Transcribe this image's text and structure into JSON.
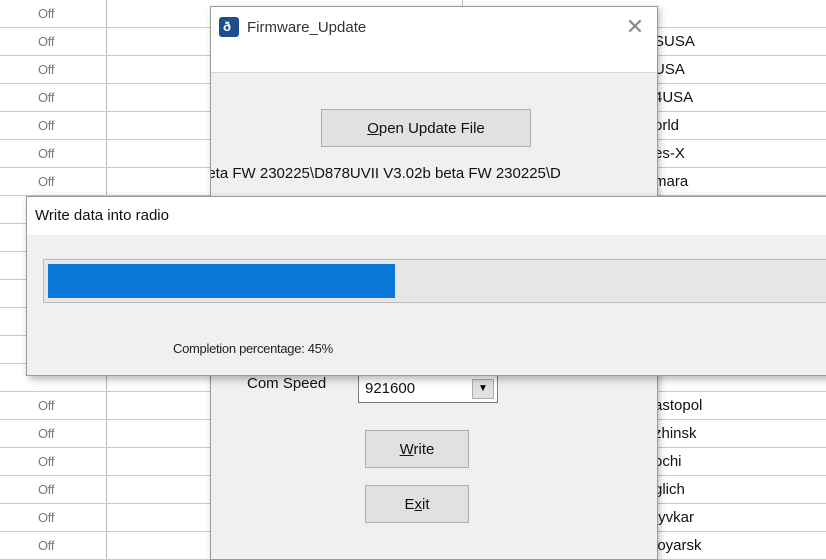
{
  "background_table": {
    "rows": [
      {
        "status": "Off",
        "name": ""
      },
      {
        "status": "Off",
        "name": "SUSA"
      },
      {
        "status": "Off",
        "name": "USA"
      },
      {
        "status": "Off",
        "name": "4USA"
      },
      {
        "status": "Off",
        "name": "orld"
      },
      {
        "status": "Off",
        "name": "es-X"
      },
      {
        "status": "Off",
        "name": "mara"
      },
      {
        "status": "",
        "name": ""
      },
      {
        "status": "",
        "name": ""
      },
      {
        "status": "",
        "name": ""
      },
      {
        "status": "",
        "name": ""
      },
      {
        "status": "",
        "name": ""
      },
      {
        "status": "",
        "name": ""
      },
      {
        "status": "",
        "name": ""
      },
      {
        "status": "Off",
        "name": "astopol"
      },
      {
        "status": "Off",
        "name": "zhinsk"
      },
      {
        "status": "Off",
        "name": "ochi"
      },
      {
        "status": "Off",
        "name": "glich"
      },
      {
        "status": "Off",
        "name": "tyvkar"
      },
      {
        "status": "Off",
        "name": "ioyarsk"
      }
    ]
  },
  "firmware_dialog": {
    "title": "Firmware_Update",
    "close_glyph": "✕",
    "open_button": {
      "pre": "",
      "accel": "O",
      "post": "pen Update File"
    },
    "file_path": "beta FW 230225\\D878UVII V3.02b beta FW 230225\\D",
    "com_speed_label": "Com Speed",
    "com_speed_value": "921600",
    "dropdown_glyph": "▼",
    "write_button": {
      "pre": "",
      "accel": "W",
      "post": "rite"
    },
    "exit_button": {
      "pre": "E",
      "accel": "x",
      "post": "it"
    }
  },
  "progress_dialog": {
    "title": "Write data into radio",
    "progress_fraction": 0.45,
    "completion_text": "Completion percentage: 45%"
  },
  "colors": {
    "progress_fill": "#0a78d7",
    "dialog_bg": "#f0f0f0"
  }
}
